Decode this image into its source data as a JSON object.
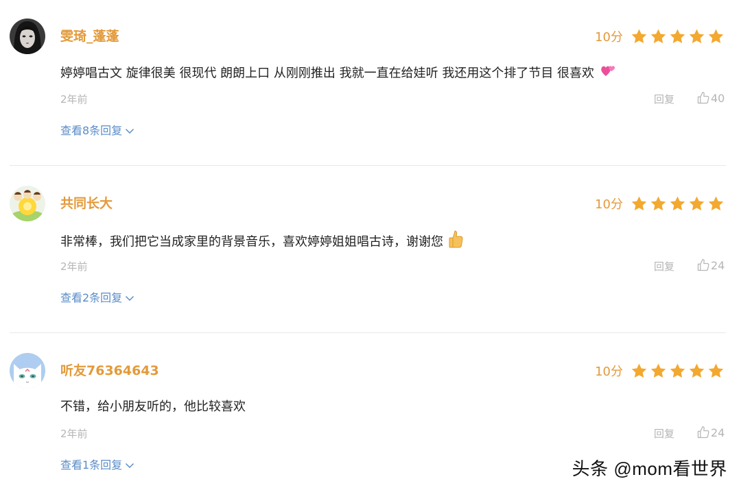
{
  "score_label": "10分",
  "star_color": "#f3a82f",
  "accent_color": "#e39a3a",
  "link_color": "#5a8cc9",
  "comments": [
    {
      "username": "雯琦_蓬蓬",
      "text": "婷婷唱古文 旋律很美 很现代 朗朗上口 从刚刚推出 我就一直在给娃听 我还用这个排了节目 很喜欢",
      "emoji": "two-hearts-icon",
      "time": "2年前",
      "reply_label": "回复",
      "likes": "40",
      "view_replies": "查看8条回复",
      "rating_stars": 5
    },
    {
      "username": "共同长大",
      "text": "非常棒，我们把它当成家里的背景音乐，喜欢婷婷姐姐唱古诗，谢谢您",
      "emoji": "thumbs-up-icon",
      "time": "2年前",
      "reply_label": "回复",
      "likes": "24",
      "view_replies": "查看2条回复",
      "rating_stars": 5
    },
    {
      "username": "听友76364643",
      "text": "不错，给小朋友听的，他比较喜欢",
      "emoji": "",
      "time": "2年前",
      "reply_label": "回复",
      "likes": "24",
      "view_replies": "查看1条回复",
      "rating_stars": 5
    }
  ],
  "watermark": "头条 @mom看世界"
}
